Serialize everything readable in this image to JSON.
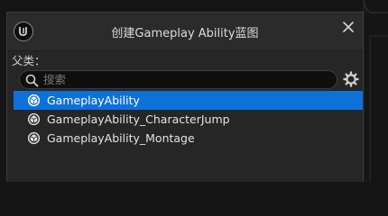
{
  "dialog": {
    "title": "创建Gameplay Ability蓝图",
    "parent_label": "父类："
  },
  "search": {
    "placeholder": "搜索",
    "value": ""
  },
  "class_list": {
    "items": [
      {
        "label": "GameplayAbility",
        "selected": true
      },
      {
        "label": "GameplayAbility_CharacterJump",
        "selected": false
      },
      {
        "label": "GameplayAbility_Montage",
        "selected": false
      }
    ]
  },
  "colors": {
    "selection": "#0e70d9",
    "dialog_bg": "#262626",
    "titlebar_bg": "#2b2b2b"
  },
  "icons": {
    "logo": "unreal-logo-icon",
    "close": "close-icon",
    "search": "search-icon",
    "settings": "gear-icon",
    "class": "gameplay-ability-class-icon"
  }
}
